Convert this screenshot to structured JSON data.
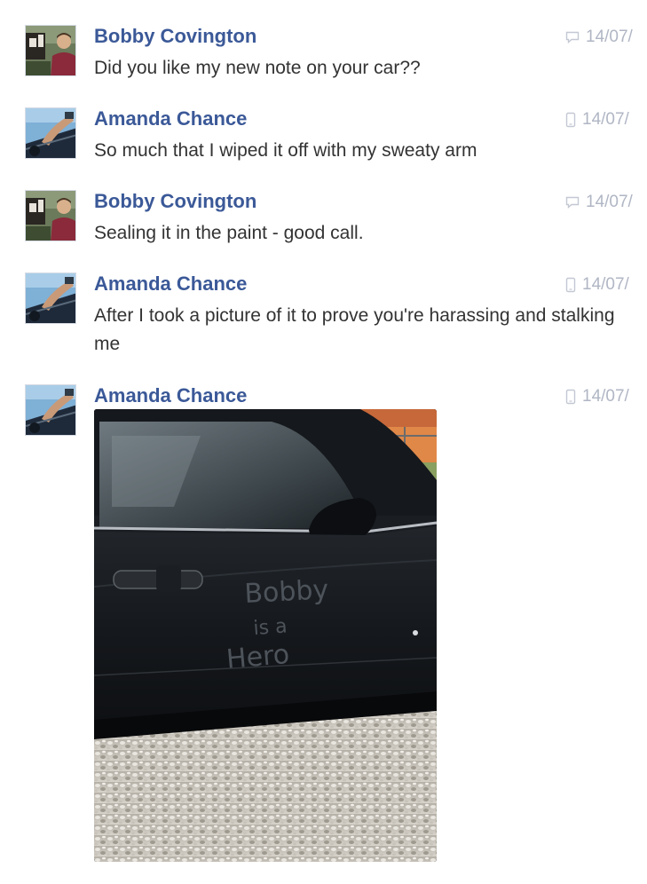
{
  "thread": {
    "messages": [
      {
        "sender": "Bobby Covington",
        "text": "Did you like my new note on your car??",
        "time": "14/07/",
        "source_icon": "chat-bubble-icon",
        "avatar": "bobby-avatar"
      },
      {
        "sender": "Amanda Chance",
        "text": "So much that I wiped it off with my sweaty arm",
        "time": "14/07/",
        "source_icon": "mobile-phone-icon",
        "avatar": "amanda-avatar"
      },
      {
        "sender": "Bobby Covington",
        "text": "Sealing it in the paint - good call.",
        "time": "14/07/",
        "source_icon": "chat-bubble-icon",
        "avatar": "bobby-avatar"
      },
      {
        "sender": "Amanda Chance",
        "text": "After I took a picture of it to prove you're harassing and stalking me",
        "time": "14/07/",
        "source_icon": "mobile-phone-icon",
        "avatar": "amanda-avatar"
      },
      {
        "sender": "Amanda Chance",
        "time": "14/07/",
        "source_icon": "mobile-phone-icon",
        "avatar": "amanda-avatar",
        "attachment": {
          "type": "photo",
          "subject": "black car door with words written in the dust",
          "dust_text": [
            "Bobby",
            "is a",
            "Hero"
          ]
        }
      }
    ]
  },
  "colors": {
    "sender_name": "#3b5998",
    "message_text": "#333333",
    "timestamp": "#b0b6c4"
  }
}
